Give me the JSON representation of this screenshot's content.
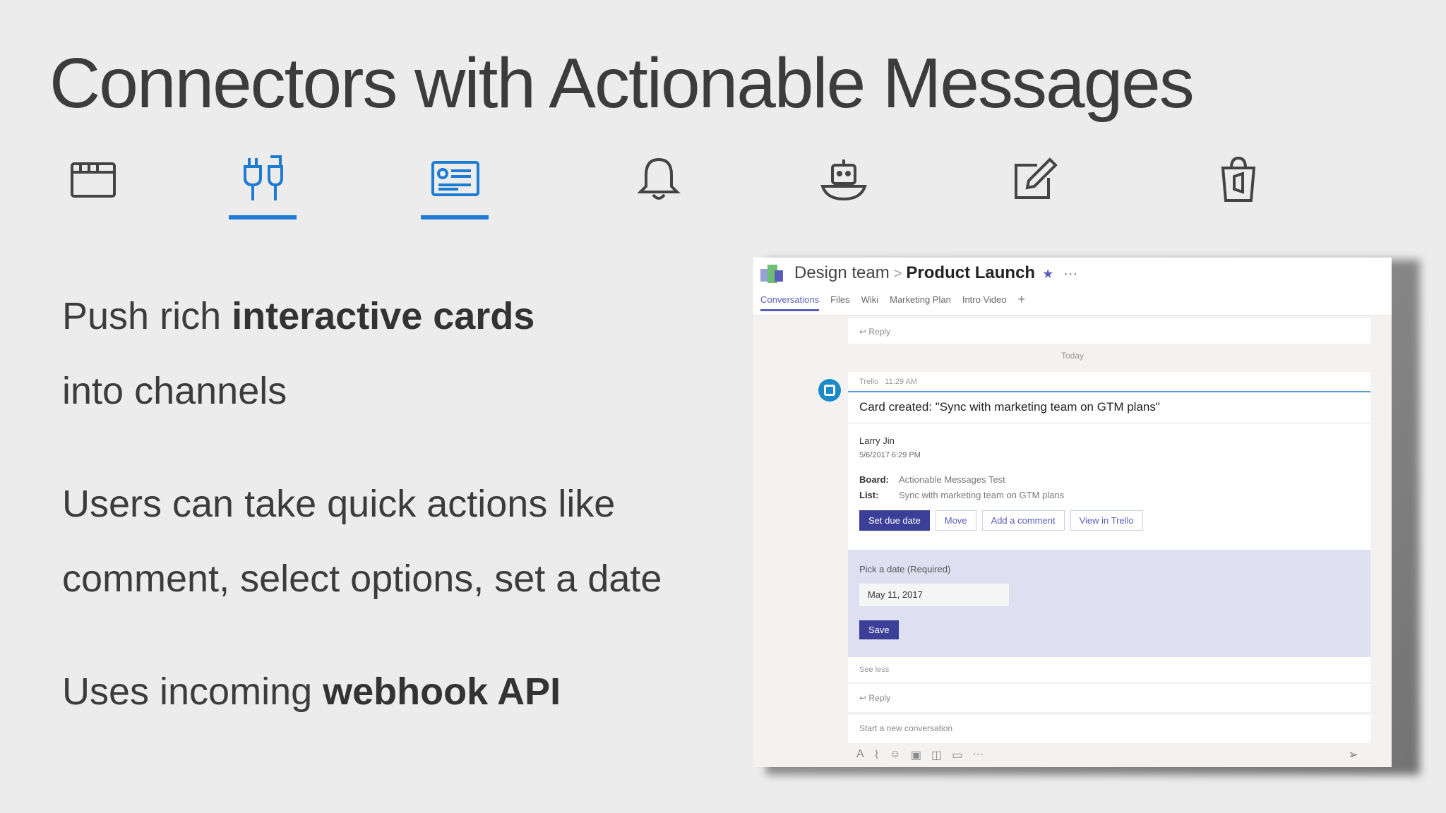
{
  "slide": {
    "title": "Connectors with Actionable Messages",
    "bullets": [
      {
        "line1_pre": "Push rich ",
        "line1_bold": "interactive cards",
        "line2": "into channels"
      },
      {
        "line1": "Users can take quick actions like",
        "line2": "comment, select options, set a date"
      },
      {
        "pre": "Uses incoming ",
        "bold": "webhook API"
      }
    ],
    "icons": [
      "tabs-icon",
      "connectors-icon",
      "cards-icon",
      "bell-icon",
      "bot-icon",
      "compose-icon",
      "store-icon"
    ],
    "active_icons": [
      "connectors-icon",
      "cards-icon"
    ],
    "accent": "#1e7bd4"
  },
  "teams": {
    "team": "Design team",
    "separator": ">",
    "channel": "Product Launch",
    "tabs": [
      "Conversations",
      "Files",
      "Wiki",
      "Marketing Plan",
      "Intro Video"
    ],
    "add_tab": "+",
    "reply_label": "Reply",
    "today": "Today",
    "message": {
      "sender": "Trello",
      "time": "11:29 AM",
      "title": "Card created: \"Sync with marketing team on GTM plans\"",
      "author": "Larry Jin",
      "date": "5/6/2017 6:29 PM",
      "facts": [
        {
          "key": "Board:",
          "value": "Actionable Messages Test"
        },
        {
          "key": "List:",
          "value": "Sync with marketing team on GTM plans"
        }
      ],
      "actions": [
        "Set due date",
        "Move",
        "Add a comment",
        "View in Trello"
      ],
      "date_label": "Pick a date (Required)",
      "date_value": "May 11, 2017",
      "save_label": "Save",
      "see_less": "See less"
    },
    "compose_placeholder": "Start a new conversation",
    "accent": "#5a5dba"
  }
}
